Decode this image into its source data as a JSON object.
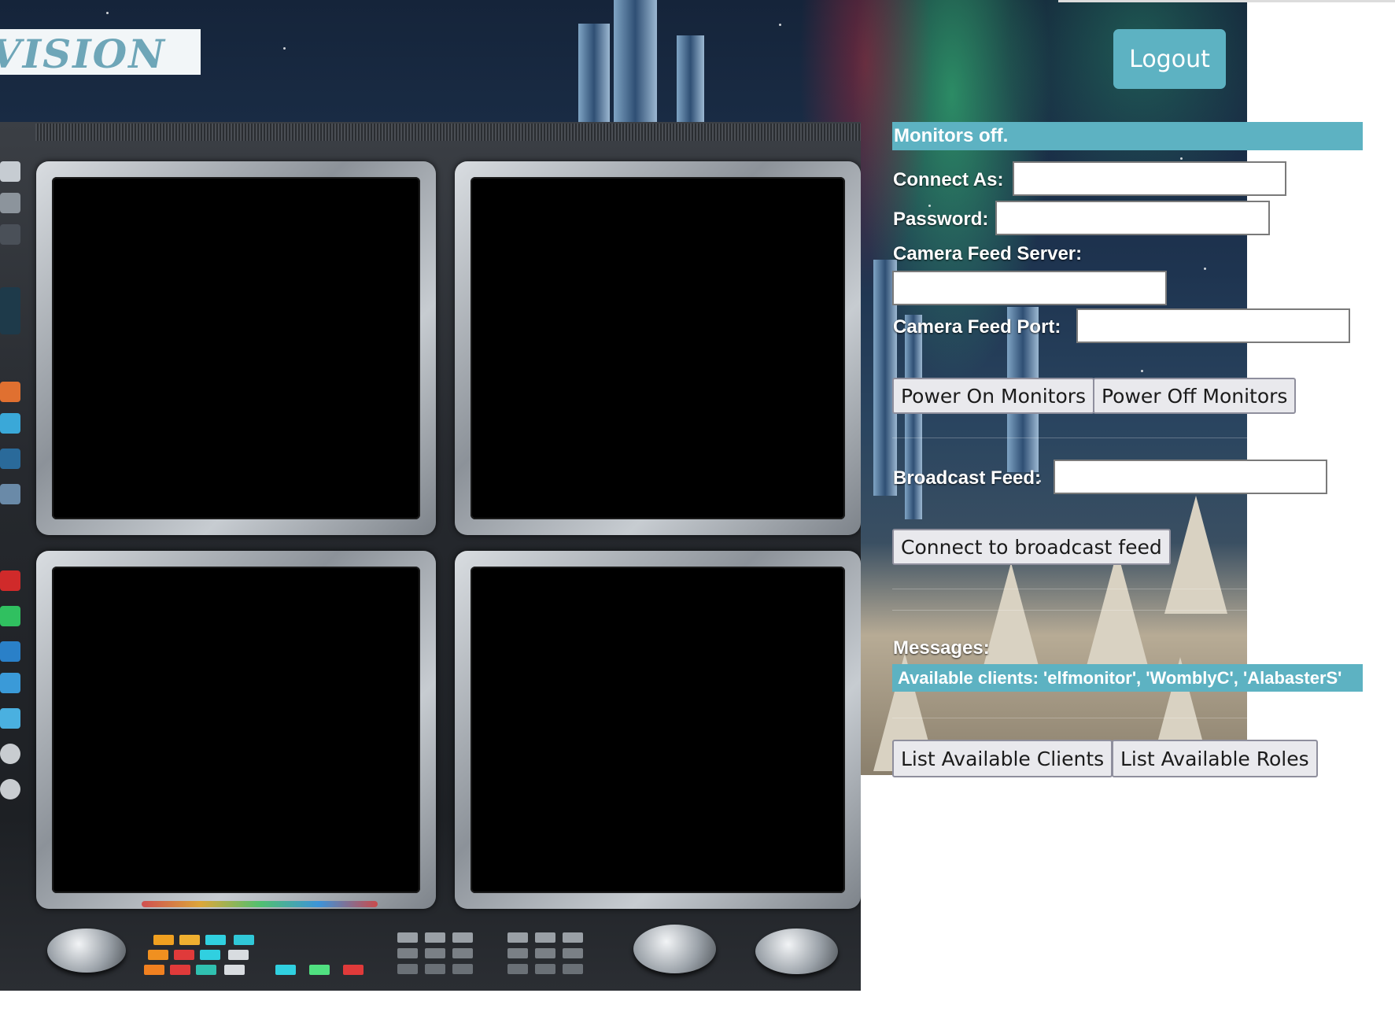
{
  "header": {
    "logo_text": "VISION",
    "logout_label": "Logout"
  },
  "status": {
    "text": "Monitors off.",
    "color": "#5db2c2"
  },
  "form": {
    "connect_as_label": "Connect As:",
    "connect_as_value": "",
    "password_label": "Password:",
    "password_value": "",
    "camera_server_label": "Camera Feed Server:",
    "camera_server_value": "",
    "camera_port_label": "Camera Feed Port:",
    "camera_port_value": ""
  },
  "monitor_controls": {
    "power_on_label": "Power On Monitors",
    "power_off_label": "Power Off Monitors"
  },
  "broadcast": {
    "label": "Broadcast Feed:",
    "value": "",
    "connect_label": "Connect to broadcast feed"
  },
  "messages": {
    "label": "Messages:",
    "items": [
      "Available clients: 'elfmonitor', 'WomblyC', 'AlabasterS'"
    ]
  },
  "actions": {
    "list_clients_label": "List Available Clients",
    "list_roles_label": "List Available Roles"
  },
  "monitors": [
    {
      "name": "monitor-1",
      "state": "off"
    },
    {
      "name": "monitor-2",
      "state": "off"
    },
    {
      "name": "monitor-3",
      "state": "off"
    },
    {
      "name": "monitor-4",
      "state": "off"
    }
  ],
  "colors": {
    "accent": "#5db2c2",
    "button_bg": "#e9e9ed",
    "screen_off": "#000000"
  }
}
